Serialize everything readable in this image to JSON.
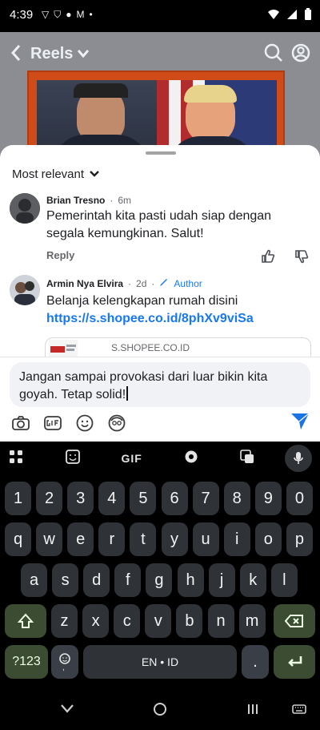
{
  "status_bar": {
    "time": "4:39",
    "icons_left": [
      "navigation-icon",
      "shield-icon",
      "mic-dot-icon",
      "gmail-icon",
      "dot-icon"
    ],
    "icons_right": [
      "wifi-icon",
      "signal-icon",
      "battery-icon"
    ]
  },
  "reels": {
    "title": "Reels"
  },
  "sheet": {
    "sort_label": "Most relevant",
    "comments": [
      {
        "name": "Brian Tresno",
        "time": "6m",
        "text": "Pemerintah kita pasti udah siap dengan segala kemungkinan. Salut!",
        "reply": "Reply"
      },
      {
        "name": "Armin Nya Elvira",
        "time": "2d",
        "author_badge": "Author",
        "text": "Belanja kelengkapan rumah disini",
        "link": "https://s.shopee.co.id/8phXv9viSa",
        "preview_domain": "S.SHOPEE.CO.ID"
      }
    ]
  },
  "composer": {
    "input_text": "Jangan sampai provokasi dari luar bikin kita goyah. Tetap solid!"
  },
  "keyboard": {
    "top_icons": [
      "apps-grid-icon",
      "sticker-icon",
      "gif-label",
      "settings-gear-icon",
      "translate-icon",
      "palette-icon",
      "mic-icon"
    ],
    "gif_label": "GIF",
    "row_numbers": [
      "1",
      "2",
      "3",
      "4",
      "5",
      "6",
      "7",
      "8",
      "9",
      "0"
    ],
    "row1": [
      "q",
      "w",
      "e",
      "r",
      "t",
      "y",
      "u",
      "i",
      "o",
      "p"
    ],
    "row2": [
      "a",
      "s",
      "d",
      "f",
      "g",
      "h",
      "j",
      "k",
      "l"
    ],
    "row3": [
      "z",
      "x",
      "c",
      "v",
      "b",
      "n",
      "m"
    ],
    "sym_label": "?123",
    "space_label": "EN • ID",
    "dot_label": "."
  },
  "colors": {
    "accent_blue": "#1877f2",
    "send_blue": "#1b74e4",
    "key_green": "#3b4c33",
    "video_orange": "#cf4b18"
  }
}
